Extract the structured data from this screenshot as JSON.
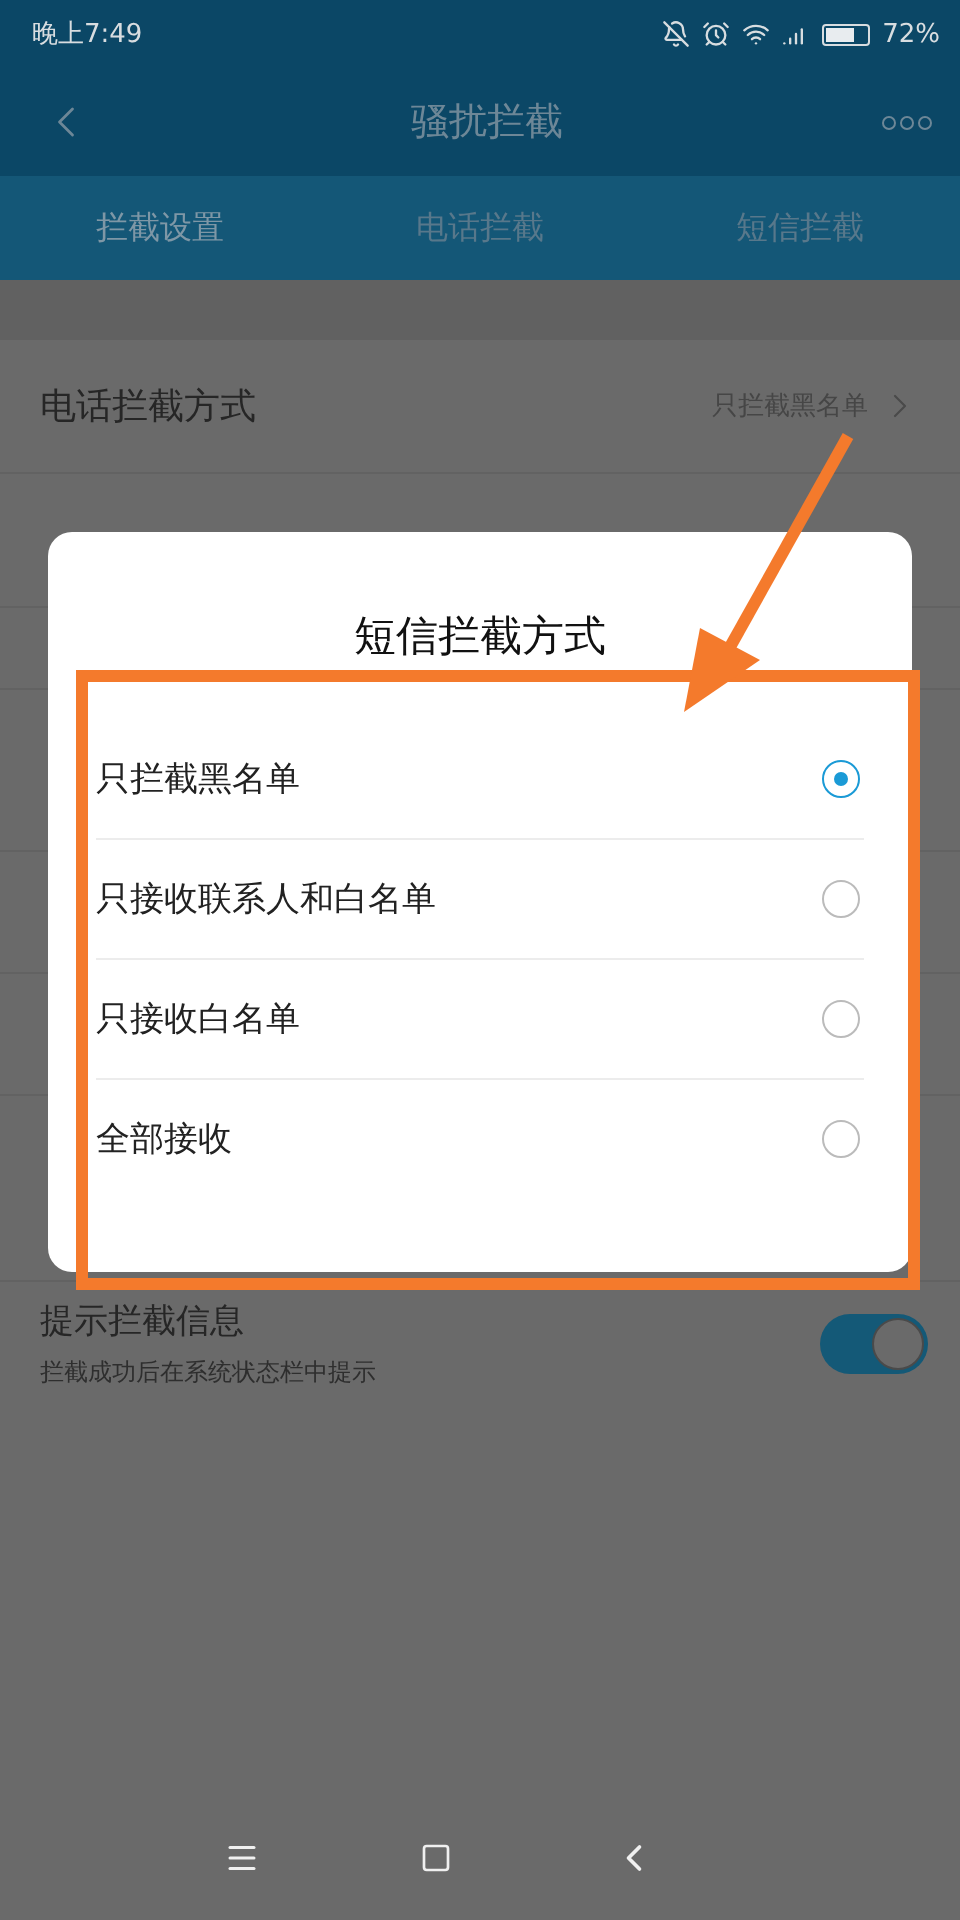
{
  "status_bar": {
    "time": "晚上7:49",
    "battery": "72%"
  },
  "header": {
    "title": "骚扰拦截"
  },
  "tabs": [
    {
      "label": "拦截设置",
      "selected": true
    },
    {
      "label": "电话拦截",
      "selected": false
    },
    {
      "label": "短信拦截",
      "selected": false
    }
  ],
  "call_row": {
    "title": "电话拦截方式",
    "value": "只拦截黑名单"
  },
  "notice_row": {
    "title": "提示拦截信息",
    "subtitle": "拦截成功后在系统状态栏中提示",
    "on": true
  },
  "dialog": {
    "title": "短信拦截方式",
    "options": [
      {
        "label": "只拦截黑名单",
        "selected": true
      },
      {
        "label": "只接收联系人和白名单",
        "selected": false
      },
      {
        "label": "只接收白名单",
        "selected": false
      },
      {
        "label": "全部接收",
        "selected": false
      }
    ]
  }
}
